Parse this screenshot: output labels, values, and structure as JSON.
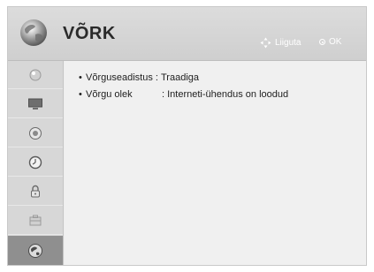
{
  "header": {
    "title": "VÕRK",
    "title_icon": "globe-icon",
    "hints": {
      "move_label": "Liiguta",
      "move_icon": "dpad-icon",
      "ok_label": "OK",
      "ok_icon": "ok-button-icon"
    }
  },
  "sidebar": {
    "items": [
      {
        "icon": "picture-icon",
        "active": false
      },
      {
        "icon": "monitor-icon",
        "active": false
      },
      {
        "icon": "speaker-icon",
        "active": false
      },
      {
        "icon": "clock-icon",
        "active": false
      },
      {
        "icon": "lock-icon",
        "active": false
      },
      {
        "icon": "options-icon",
        "active": false
      },
      {
        "icon": "network-icon",
        "active": true
      }
    ]
  },
  "content": {
    "rows": [
      {
        "label": "Võrguseadistus",
        "separator": " : ",
        "value": "Traadiga"
      },
      {
        "label": "Võrgu olek",
        "separator": ": ",
        "value": "Interneti-ühendus on loodud"
      }
    ]
  },
  "colors": {
    "header_bg": "#d6d6d6",
    "sidebar_bg": "#d7d7d7",
    "active_item_bg": "#8f8f8f",
    "content_bg": "#f0f0f0"
  }
}
